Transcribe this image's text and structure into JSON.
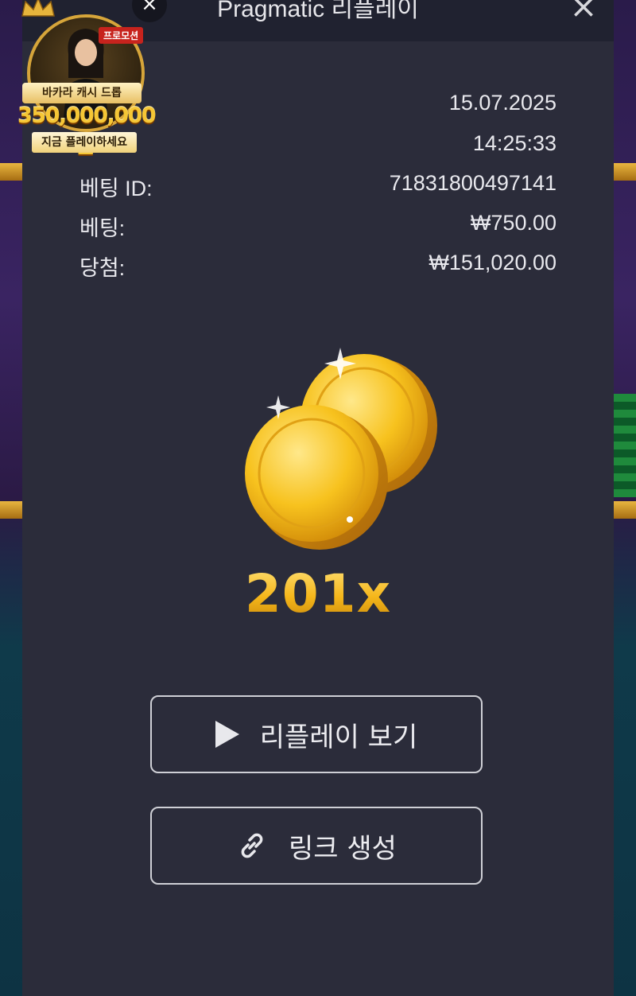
{
  "modal": {
    "title": "Pragmatic 리플레이",
    "close_symbol": "×"
  },
  "details": [
    {
      "label": "",
      "value": "15.07.2025"
    },
    {
      "label": "",
      "value": "14:25:33"
    },
    {
      "label": "베팅 ID:",
      "value": "71831800497141"
    },
    {
      "label": "베팅:",
      "value": "₩750.00"
    },
    {
      "label": "당첨:",
      "value": "₩151,020.00"
    }
  ],
  "win": {
    "multiplier": "201x",
    "icon": "gold-coins-icon"
  },
  "buttons": {
    "replay_label": "리플레이 보기",
    "link_label": "링크 생성"
  },
  "promo": {
    "tag": "프로모션",
    "ribbon": "바카라 캐시 드롭",
    "amount": "350,000,000원",
    "cta": "지금 플레이하세요",
    "close_symbol": "×"
  },
  "colors": {
    "modal_bg": "#2b2c3a",
    "header_bg": "#202230",
    "accent_gold": "#f5b61a"
  }
}
